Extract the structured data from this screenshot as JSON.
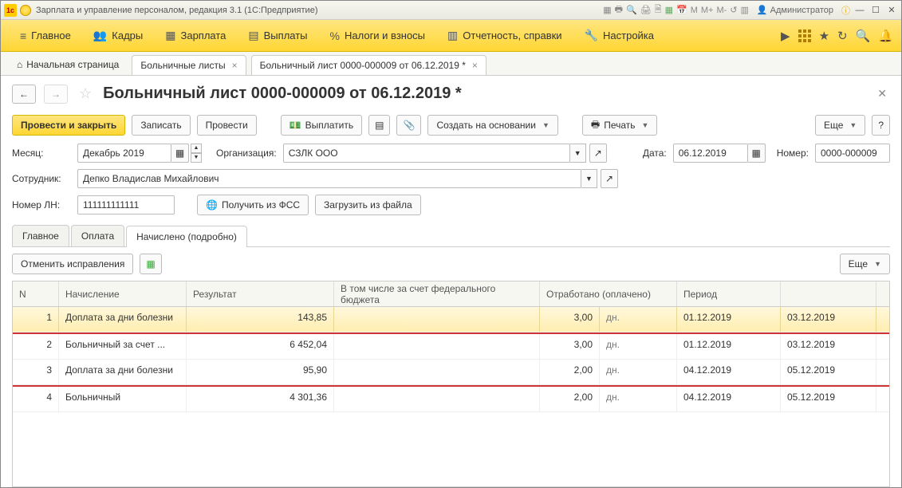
{
  "titlebar": {
    "app_title": "Зарплата и управление персоналом, редакция 3.1  (1С:Предприятие)",
    "admin_label": "Администратор",
    "text_marks": {
      "m": "M",
      "mplus": "M+",
      "mminus": "M-"
    }
  },
  "mainmenu": {
    "items": [
      {
        "label": "Главное"
      },
      {
        "label": "Кадры"
      },
      {
        "label": "Зарплата"
      },
      {
        "label": "Выплаты"
      },
      {
        "label": "Налоги и взносы"
      },
      {
        "label": "Отчетность, справки"
      },
      {
        "label": "Настройка"
      }
    ]
  },
  "tabs": {
    "home": "Начальная страница",
    "items": [
      {
        "label": "Больничные листы"
      },
      {
        "label": "Больничный лист 0000-000009 от 06.12.2019 *",
        "active": true
      }
    ]
  },
  "doc": {
    "title": "Больничный лист 0000-000009 от 06.12.2019 *"
  },
  "toolbar": {
    "post_close": "Провести и закрыть",
    "save": "Записать",
    "post": "Провести",
    "pay": "Выплатить",
    "create_on_basis": "Создать на основании",
    "print": "Печать",
    "more": "Еще",
    "help": "?"
  },
  "form": {
    "month_label": "Месяц:",
    "month_value": "Декабрь 2019",
    "org_label": "Организация:",
    "org_value": "СЗЛК ООО",
    "date_label": "Дата:",
    "date_value": "06.12.2019",
    "number_label": "Номер:",
    "number_value": "0000-000009",
    "employee_label": "Сотрудник:",
    "employee_value": "Депко Владислав Михайлович",
    "ln_label": "Номер ЛН:",
    "ln_value": "111111111111",
    "get_from_fss": "Получить из ФСС",
    "load_from_file": "Загрузить из файла"
  },
  "subtabs": {
    "main": "Главное",
    "payment": "Оплата",
    "accrued": "Начислено (подробно)"
  },
  "grid_toolbar": {
    "undo_fix": "Отменить исправления",
    "more": "Еще"
  },
  "grid": {
    "headers": {
      "n": "N",
      "accrual": "Начисление",
      "result": "Результат",
      "federal": "В том числе за счет федерального бюджета",
      "worked": "Отработано (оплачено)",
      "period": "Период"
    },
    "rows": [
      {
        "n": "1",
        "accrual": "Доплата за дни болезни",
        "result": "143,85",
        "federal": "",
        "worked": "3,00",
        "unit": "дн.",
        "period_from": "01.12.2019",
        "period_to": "03.12.2019",
        "highlight": true,
        "separator": true
      },
      {
        "n": "2",
        "accrual": "Больничный за счет ...",
        "result": "6 452,04",
        "federal": "",
        "worked": "3,00",
        "unit": "дн.",
        "period_from": "01.12.2019",
        "period_to": "03.12.2019"
      },
      {
        "n": "3",
        "accrual": "Доплата за дни болезни",
        "result": "95,90",
        "federal": "",
        "worked": "2,00",
        "unit": "дн.",
        "period_from": "04.12.2019",
        "period_to": "05.12.2019",
        "separator": true
      },
      {
        "n": "4",
        "accrual": "Больничный",
        "result": "4 301,36",
        "federal": "",
        "worked": "2,00",
        "unit": "дн.",
        "period_from": "04.12.2019",
        "period_to": "05.12.2019"
      }
    ]
  }
}
